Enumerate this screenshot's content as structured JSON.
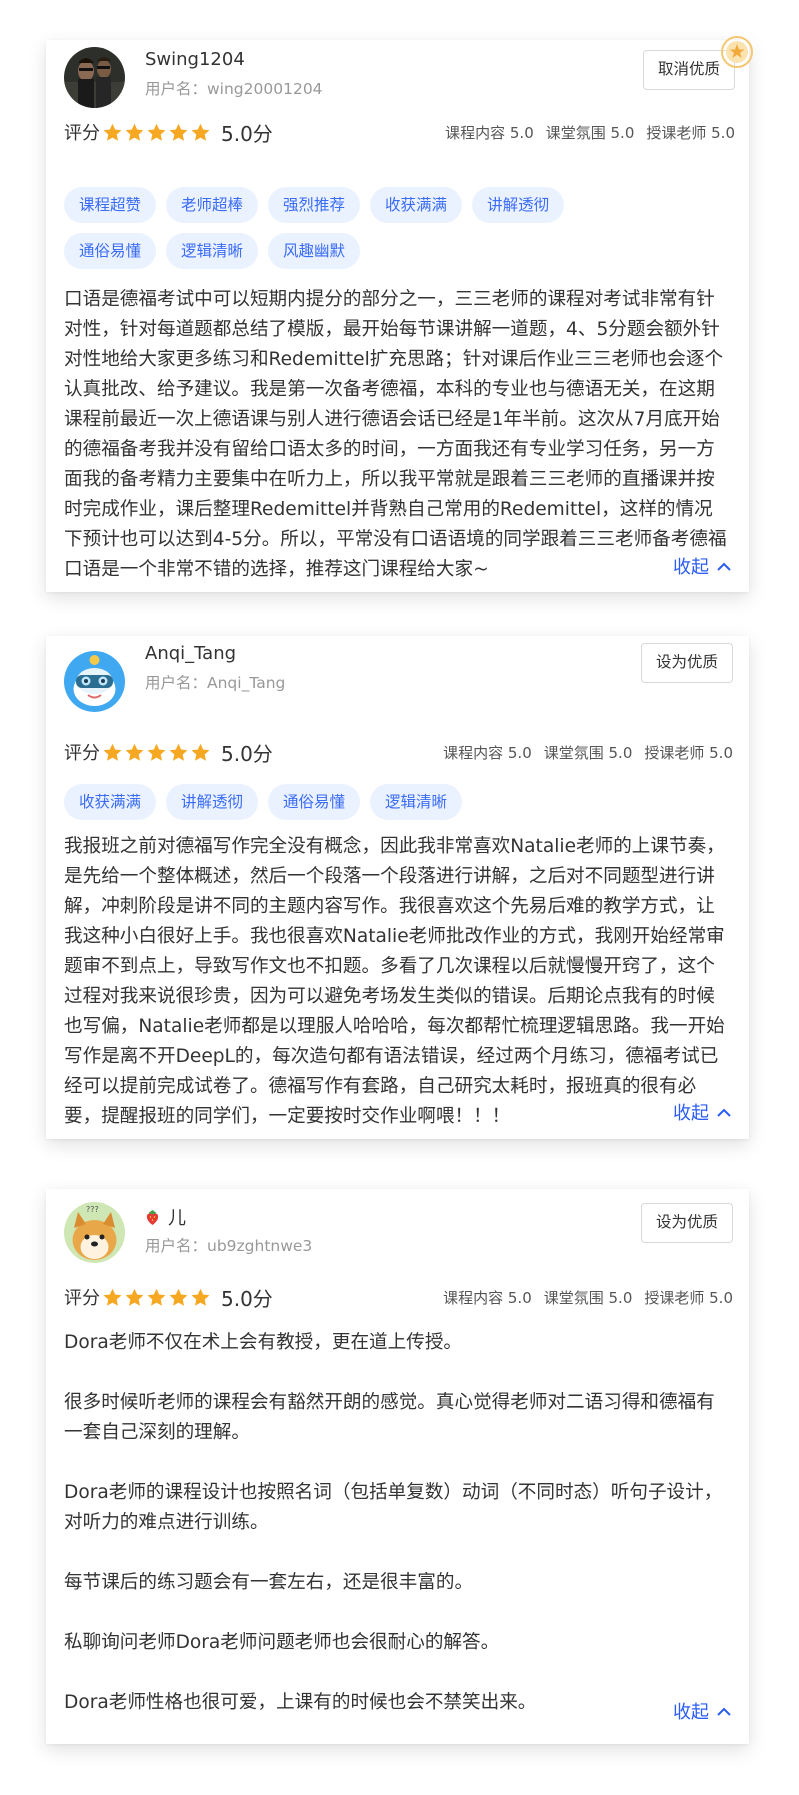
{
  "reviews": [
    {
      "username": "Swing1204",
      "userid": "用户名：wing20001204",
      "action": "取消优质",
      "rating_label": "评分",
      "score": "5.0分",
      "stars": 5,
      "sub_content": "课程内容 5.0",
      "sub_atmosphere": "课堂氛围 5.0",
      "sub_teacher": "授课老师 5.0",
      "tags": [
        "课程超赞",
        "老师超棒",
        "强烈推荐",
        "收获满满",
        "讲解透彻",
        "通俗易懂",
        "逻辑清晰",
        "风趣幽默"
      ],
      "paragraphs": [
        "口语是德福考试中可以短期内提分的部分之一，三三老师的课程对考试非常有针对性，针对每道题都总结了模版，最开始每节课讲解一道题，4、5分题会额外针对性地给大家更多练习和Redemittel扩充思路；针对课后作业三三老师也会逐个认真批改、给予建议。我是第一次备考德福，本科的专业也与德语无关，在这期课程前最近一次上德语课与别人进行德语会话已经是1年半前。这次从7月底开始的德福备考我并没有留给口语太多的时间，一方面我还有专业学习任务，另一方面我的备考精力主要集中在听力上，所以我平常就是跟着三三老师的直播课并按时完成作业，课后整理Redemittel并背熟自己常用的Redemittel，这样的情况下预计也可以达到4-5分。所以，平常没有口语语境的同学跟着三三老师备考德福口语是一个非常不错的选择，推荐这门课程给大家~"
      ],
      "collapse": "收起"
    },
    {
      "username": "Anqi_Tang",
      "userid": "用户名：Anqi_Tang",
      "action": "设为优质",
      "rating_label": "评分",
      "score": "5.0分",
      "stars": 5,
      "sub_content": "课程内容 5.0",
      "sub_atmosphere": "课堂氛围 5.0",
      "sub_teacher": "授课老师 5.0",
      "tags": [
        "收获满满",
        "讲解透彻",
        "通俗易懂",
        "逻辑清晰"
      ],
      "paragraphs": [
        "我报班之前对德福写作完全没有概念，因此我非常喜欢Natalie老师的上课节奏，是先给一个整体概述，然后一个段落一个段落进行讲解，之后对不同题型进行讲解，冲刺阶段是讲不同的主题内容写作。我很喜欢这个先易后难的教学方式，让我这种小白很好上手。我也很喜欢Natalie老师批改作业的方式，我刚开始经常审题审不到点上，导致写作文也不扣题。多看了几次课程以后就慢慢开窍了，这个过程对我来说很珍贵，因为可以避免考场发生类似的错误。后期论点我有的时候也写偏，Natalie老师都是以理服人哈哈哈，每次都帮忙梳理逻辑思路。我一开始写作是离不开DeepL的，每次造句都有语法错误，经过两个月练习，德福考试已经可以提前完成试卷了。德福写作有套路，自己研究太耗时，报班真的很有必要，提醒报班的同学们，一定要按时交作业啊喂！！！"
      ],
      "collapse": "收起"
    },
    {
      "username": "儿",
      "userid": "用户名：ub9zghtnwe3",
      "action": "设为优质",
      "rating_label": "评分",
      "score": "5.0分",
      "stars": 5,
      "sub_content": "课程内容 5.0",
      "sub_atmosphere": "课堂氛围 5.0",
      "sub_teacher": "授课老师 5.0",
      "tags": [],
      "paragraphs": [
        "Dora老师不仅在术上会有教授，更在道上传授。",
        "很多时候听老师的课程会有豁然开朗的感觉。真心觉得老师对二语习得和德福有一套自己深刻的理解。",
        "Dora老师的课程设计也按照名词（包括单复数）动词（不同时态）听句子设计，对听力的难点进行训练。",
        "每节课后的练习题会有一套左右，还是很丰富的。",
        "私聊询问老师Dora老师问题老师也会很耐心的解答。",
        "Dora老师性格也很可爱，上课有的时候也会不禁笑出来。"
      ],
      "collapse": "收起"
    }
  ],
  "colors": {
    "accent": "#2b5cf5",
    "tag_bg": "#eaf1ff",
    "tag_text": "#3b6cf6",
    "star": "#f7a823"
  },
  "icons": [
    "avatar-image",
    "star-icon",
    "chevron-up-icon",
    "quality-badge-icon",
    "strawberry-icon"
  ]
}
